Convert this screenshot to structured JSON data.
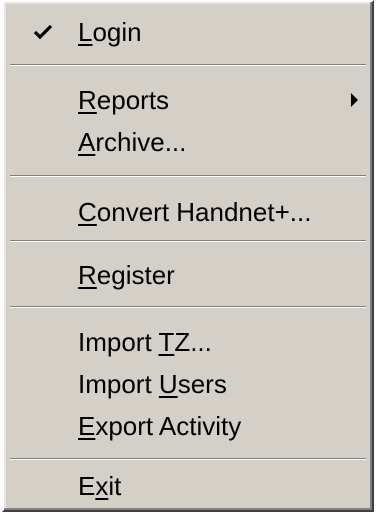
{
  "menu": {
    "items": [
      {
        "pre": "",
        "mnemonic": "L",
        "post": "ogin",
        "checked": true,
        "submenu": false
      },
      {
        "pre": "",
        "mnemonic": "R",
        "post": "eports",
        "checked": false,
        "submenu": true
      },
      {
        "pre": "",
        "mnemonic": "A",
        "post": "rchive...",
        "checked": false,
        "submenu": false
      },
      {
        "pre": "",
        "mnemonic": "C",
        "post": "onvert Handnet+...",
        "checked": false,
        "submenu": false
      },
      {
        "pre": "",
        "mnemonic": "R",
        "post": "egister",
        "checked": false,
        "submenu": false
      },
      {
        "pre": "Import ",
        "mnemonic": "T",
        "post": "Z...",
        "checked": false,
        "submenu": false
      },
      {
        "pre": "Import ",
        "mnemonic": "U",
        "post": "sers",
        "checked": false,
        "submenu": false
      },
      {
        "pre": "",
        "mnemonic": "E",
        "post": "xport Activity",
        "checked": false,
        "submenu": false
      },
      {
        "pre": "E",
        "mnemonic": "x",
        "post": "it",
        "checked": false,
        "submenu": false
      }
    ],
    "colors": {
      "background": "#d4d0c8",
      "text": "#000000",
      "separator_shadow": "#808080",
      "separator_highlight": "#ffffff"
    }
  }
}
